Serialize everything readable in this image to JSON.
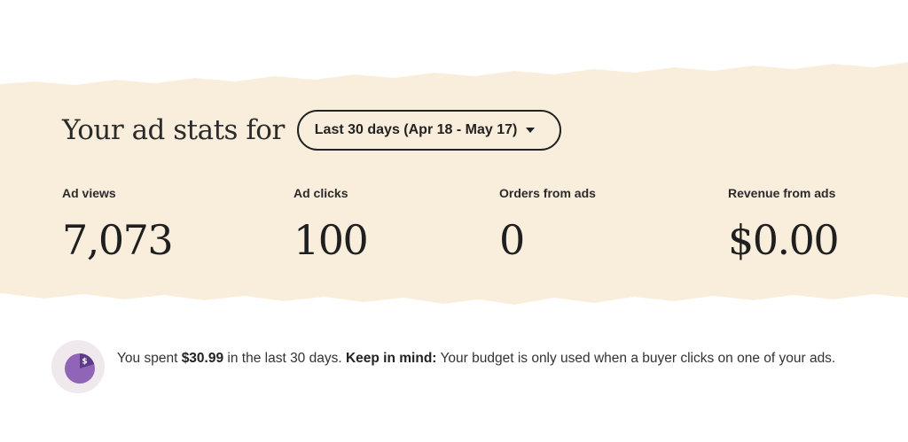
{
  "heading": {
    "title": "Your ad stats for"
  },
  "range": {
    "label": "Last 30 days (Apr 18 - May 17)"
  },
  "stats": [
    {
      "label": "Ad views",
      "value": "7,073"
    },
    {
      "label": "Ad clicks",
      "value": "100"
    },
    {
      "label": "Orders from ads",
      "value": "0"
    },
    {
      "label": "Revenue from ads",
      "value": "$0.00"
    }
  ],
  "note": {
    "part1": "You spent ",
    "amount": "$30.99",
    "part2": " in the last 30 days. ",
    "emphasis": "Keep in mind:",
    "part3": " Your budget is only used when a buyer clicks on one of your ads."
  },
  "icon": {
    "name": "budget-pie-icon",
    "glyph": "$"
  },
  "colors": {
    "band": "#f9eedc",
    "icon_bg": "#efe8ec",
    "icon_purple": "#9065b8",
    "icon_dark": "#5e3b86"
  }
}
